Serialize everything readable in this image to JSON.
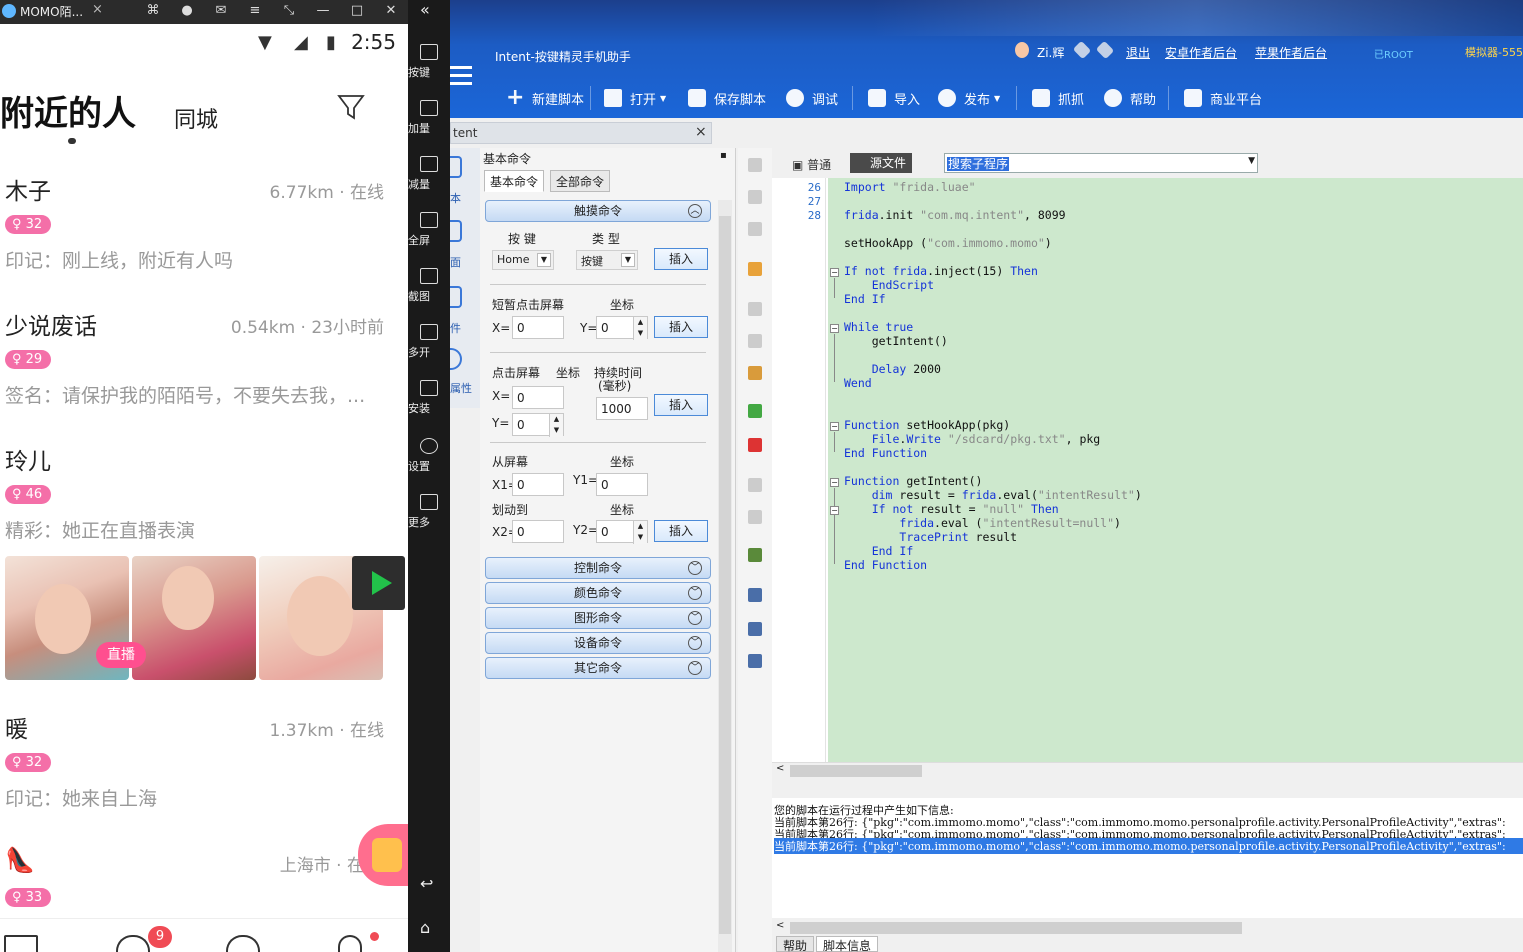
{
  "emulator": {
    "window_title": "MOMO陌...",
    "clock": "2:55",
    "page_title": "附近的人",
    "tab_city": "同城",
    "people": [
      {
        "name": "木子",
        "distance": "6.77km · 在线",
        "badge": "32",
        "sign": "印记：刚上线，附近有人吗"
      },
      {
        "name": "少说废话",
        "distance": "0.54km · 23小时前",
        "badge": "29",
        "sign": "签名：请保护我的陌陌号，不要失去我，..."
      },
      {
        "name": "玲儿",
        "distance": "",
        "badge": "46",
        "sign": "精彩：她正在直播表演"
      },
      {
        "name": "暖",
        "distance": "1.37km · 在线",
        "badge": "32",
        "sign": "印记：她来自上海"
      },
      {
        "name": "",
        "distance": "上海市 · 在",
        "badge": "33",
        "sign": ""
      }
    ],
    "live_tag": "直播",
    "nav_badge": "9"
  },
  "emu_side": {
    "items": [
      "按键",
      "加量",
      "减量",
      "全屏",
      "截图",
      "多开",
      "安装",
      "设置",
      "更多"
    ]
  },
  "app": {
    "title": "Intent-按键精灵手机助手",
    "user": "Zi.辉",
    "links": {
      "logout": "退出",
      "android_backend": "安卓作者后台",
      "apple_backend": "苹果作者后台"
    },
    "root_badge": "已ROOT",
    "sim_label": "模拟器-555",
    "toolbar": {
      "new_script": "新建脚本",
      "open": "打开",
      "save": "保存脚本",
      "debug": "调试",
      "import": "导入",
      "publish": "发布",
      "capture": "抓抓",
      "help": "帮助",
      "business": "商业平台"
    },
    "doc_tab": "tent",
    "dock_tabs": [
      "本",
      "面",
      "件",
      "属性"
    ],
    "cmd_panel": {
      "title": "基本命令",
      "tab_basic": "基本命令",
      "tab_all": "全部命令",
      "group_touch": "触摸命令",
      "key_label": "按 键",
      "type_label": "类 型",
      "key_value": "Home",
      "type_value": "按键",
      "insert": "插入",
      "tap_label": "短暂点击屏幕",
      "coord_label": "坐标",
      "x_label": "X=",
      "y_label": "Y=",
      "tap_x": "0",
      "tap_y": "0",
      "click_label": "点击屏幕",
      "duration_label": "持续时间",
      "duration_unit": "(毫秒)",
      "click_x": "0",
      "click_y": "0",
      "duration": "1000",
      "from_label": "从屏幕",
      "to_label": "划动到",
      "x1_label": "X1=",
      "y1_label": "Y1=",
      "x2_label": "X2=",
      "y2_label": "Y2=",
      "x1": "0",
      "y1": "0",
      "x2": "0",
      "y2": "0",
      "group_control": "控制命令",
      "group_color": "颜色命令",
      "group_shape": "图形命令",
      "group_device": "设备命令",
      "group_other": "其它命令"
    },
    "editor": {
      "mode_normal": "普通",
      "mode_source": "源文件",
      "sub_search": "搜索子程序",
      "line_numbers": [
        "26",
        "27",
        "28"
      ]
    },
    "output": {
      "header": "您的脚本在运行过程中产生如下信息:",
      "lines": [
        "当前脚本第26行: {\"pkg\":\"com.immomo.momo\",\"class\":\"com.immomo.momo.personalprofile.activity.PersonalProfileActivity\",\"extras\":",
        "当前脚本第26行: {\"pkg\":\"com.immomo.momo\",\"class\":\"com.immomo.momo.personalprofile.activity.PersonalProfileActivity\",\"extras\":",
        "当前脚本第26行: {\"pkg\":\"com.immomo.momo\",\"class\":\"com.immomo.momo.personalprofile.activity.PersonalProfileActivity\",\"extras\":"
      ]
    },
    "bottom_tabs": [
      "帮助",
      "脚本信息"
    ]
  }
}
